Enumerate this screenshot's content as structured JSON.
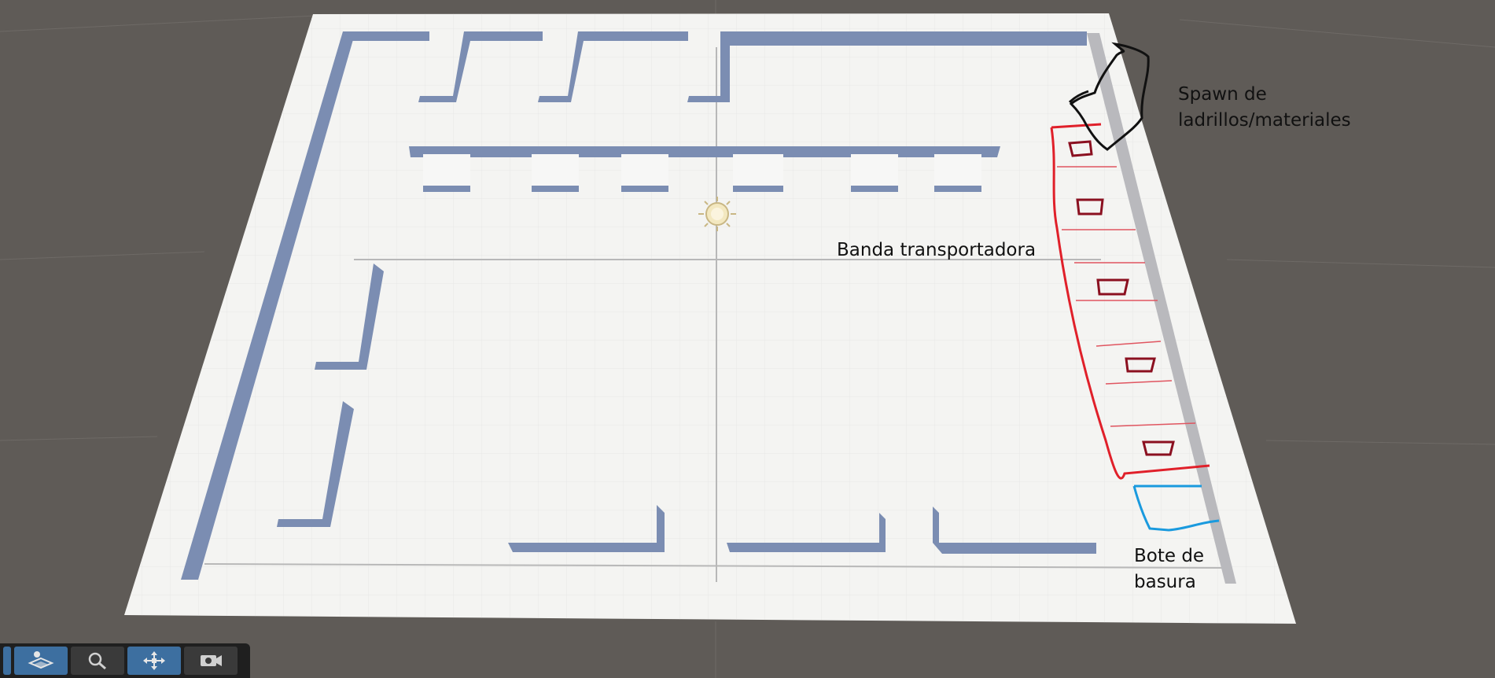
{
  "annotations": {
    "spawn_line1": "Spawn de",
    "spawn_line2": "ladrillos/materiales",
    "conveyor": "Banda transportadora",
    "trash_line1": "Bote de",
    "trash_line2": "basura"
  },
  "colors": {
    "background": "#5f5b57",
    "floor": "#f2f2f0",
    "wall_shadow": "#7b8db2",
    "conveyor_outline": "#e0202a",
    "bricks_outline": "#8b1020",
    "trash_outline": "#1a9ade",
    "spawn_outline": "#111111",
    "toolbar_active": "#3d6fa0"
  },
  "toolbar": {
    "tools": [
      {
        "icon": "edge-tool-icon",
        "active": true
      },
      {
        "icon": "layers-icon",
        "active": true
      },
      {
        "icon": "magnifier-icon",
        "active": false
      },
      {
        "icon": "move-arrows-icon",
        "active": true
      },
      {
        "icon": "camera-icon",
        "active": false
      }
    ]
  }
}
